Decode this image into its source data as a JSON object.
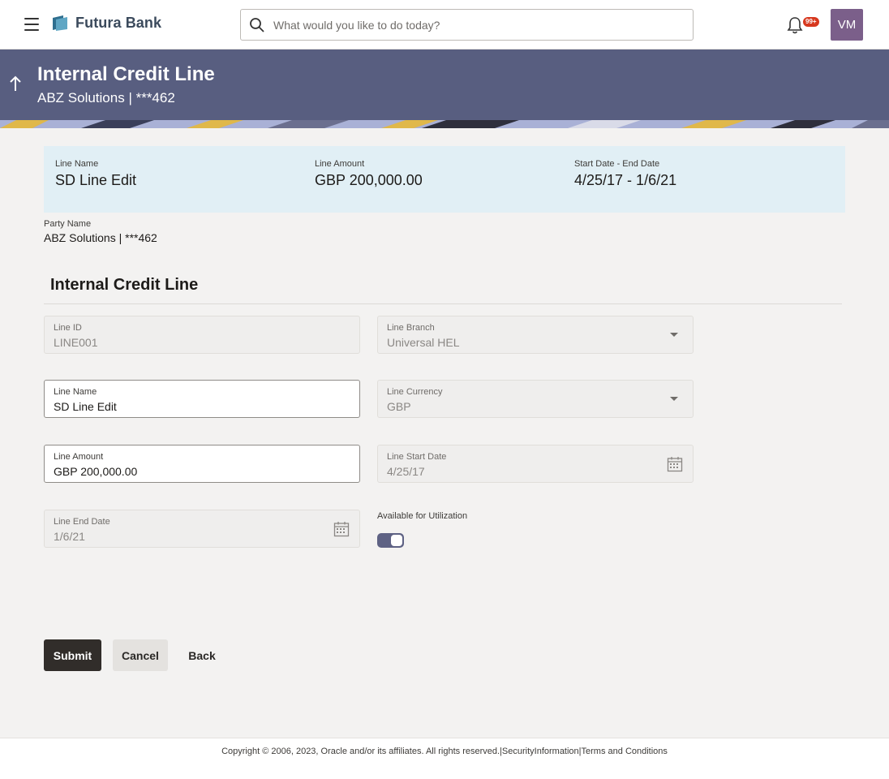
{
  "header": {
    "brand": "Futura Bank",
    "search_placeholder": "What would you like to do today?",
    "notification_count": "99+",
    "avatar_initials": "VM"
  },
  "banner": {
    "title": "Internal Credit Line",
    "subtitle": "ABZ Solutions | ***462"
  },
  "summary": {
    "line_name_label": "Line Name",
    "line_name_value": "SD Line Edit",
    "line_amount_label": "Line Amount",
    "line_amount_value": "GBP 200,000.00",
    "dates_label": "Start Date - End Date",
    "dates_value": "4/25/17 - 1/6/21"
  },
  "party": {
    "label": "Party Name",
    "value": "ABZ Solutions | ***462"
  },
  "form": {
    "section_title": "Internal Credit Line",
    "line_id_label": "Line ID",
    "line_id_value": "LINE001",
    "line_branch_label": "Line Branch",
    "line_branch_value": "Universal HEL",
    "line_name_label": "Line Name",
    "line_name_value": "SD Line Edit",
    "line_currency_label": "Line Currency",
    "line_currency_value": "GBP",
    "line_amount_label": "Line Amount",
    "line_amount_value": "GBP 200,000.00",
    "line_start_date_label": "Line Start Date",
    "line_start_date_value": "4/25/17",
    "line_end_date_label": "Line End Date",
    "line_end_date_value": "1/6/21",
    "available_label": "Available for Utilization",
    "available_enabled": true
  },
  "actions": {
    "submit": "Submit",
    "cancel": "Cancel",
    "back": "Back"
  },
  "footer": {
    "copyright": "Copyright © 2006, 2023, Oracle and/or its affiliates. All rights reserved.|",
    "security": "SecurityInformation",
    "separator": "|",
    "terms": "Terms and Conditions"
  },
  "colors": {
    "banner": "#585e80",
    "summary_bg": "#e1eff5",
    "submit_bg": "#312d2a",
    "toggle_on": "#5e6284",
    "badge": "#d7381e",
    "avatar": "#7b5f8a"
  }
}
